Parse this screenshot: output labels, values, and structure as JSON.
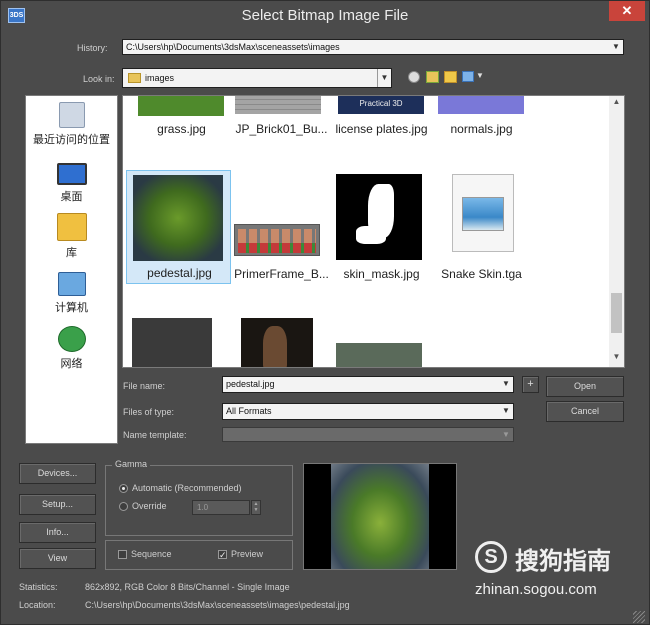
{
  "window": {
    "title": "Select Bitmap Image File",
    "close_glyph": "✕",
    "app_icon_text": "3DS"
  },
  "history": {
    "label": "History:",
    "value": "C:\\Users\\hp\\Documents\\3dsMax\\sceneassets\\images"
  },
  "lookin": {
    "label": "Look in:",
    "value": "images"
  },
  "toolbar": {
    "icons": [
      "back-icon",
      "up-folder-icon",
      "new-folder-icon",
      "view-menu-icon"
    ]
  },
  "places": [
    {
      "label": "最近访问的位置",
      "icon": "recent-places-icon"
    },
    {
      "label": "桌面",
      "icon": "desktop-icon"
    },
    {
      "label": "库",
      "icon": "libraries-icon"
    },
    {
      "label": "计算机",
      "icon": "computer-icon"
    },
    {
      "label": "网络",
      "icon": "network-icon"
    }
  ],
  "files": [
    {
      "name": "grass.jpg",
      "color": "#4f8a2c"
    },
    {
      "name": "JP_Brick01_Bu...",
      "color": "#9a9a9a"
    },
    {
      "name": "license plates.jpg",
      "color": "#1d2f5a",
      "thumb_text": "Practical 3D"
    },
    {
      "name": "normals.jpg",
      "color": "#7a78d8"
    },
    {
      "name": "pedestal.jpg",
      "color": "#4a7a2a",
      "selected": true
    },
    {
      "name": "PrimerFrame_B...",
      "color": "#b88a70"
    },
    {
      "name": "skin_mask.jpg",
      "color": "#000000"
    },
    {
      "name": "Snake Skin.tga",
      "color": "#6aa8d8"
    },
    {
      "name": "",
      "color": "#3a3a3a"
    },
    {
      "name": "",
      "color": "#2a241e"
    },
    {
      "name": "",
      "color": "#5a6a5a"
    }
  ],
  "filename": {
    "label": "File name:",
    "value": "pedestal.jpg",
    "plus": "+"
  },
  "filetype": {
    "label": "Files of type:",
    "value": "All Formats"
  },
  "nametemplate": {
    "label": "Name template:",
    "value": ""
  },
  "buttons": {
    "open": "Open",
    "cancel": "Cancel",
    "devices": "Devices...",
    "setup": "Setup...",
    "info": "Info...",
    "view": "View"
  },
  "gamma": {
    "title": "Gamma",
    "automatic": "Automatic (Recommended)",
    "override": "Override",
    "override_value": "1.0"
  },
  "options": {
    "sequence": "Sequence",
    "preview": "Preview",
    "preview_checked": "✓"
  },
  "statistics": {
    "label": "Statistics:",
    "value": "862x892, RGB Color 8 Bits/Channel - Single Image"
  },
  "location": {
    "label": "Location:",
    "value": "C:\\Users\\hp\\Documents\\3dsMax\\sceneassets\\images\\pedestal.jpg"
  },
  "watermark": {
    "brand": "搜狗指南",
    "url": "zhinan.sogou.com",
    "logo_glyph": "S"
  },
  "colors": {
    "window_bg": "#4b4b4b",
    "selection": "#d4e8f8",
    "close": "#c9443b"
  }
}
